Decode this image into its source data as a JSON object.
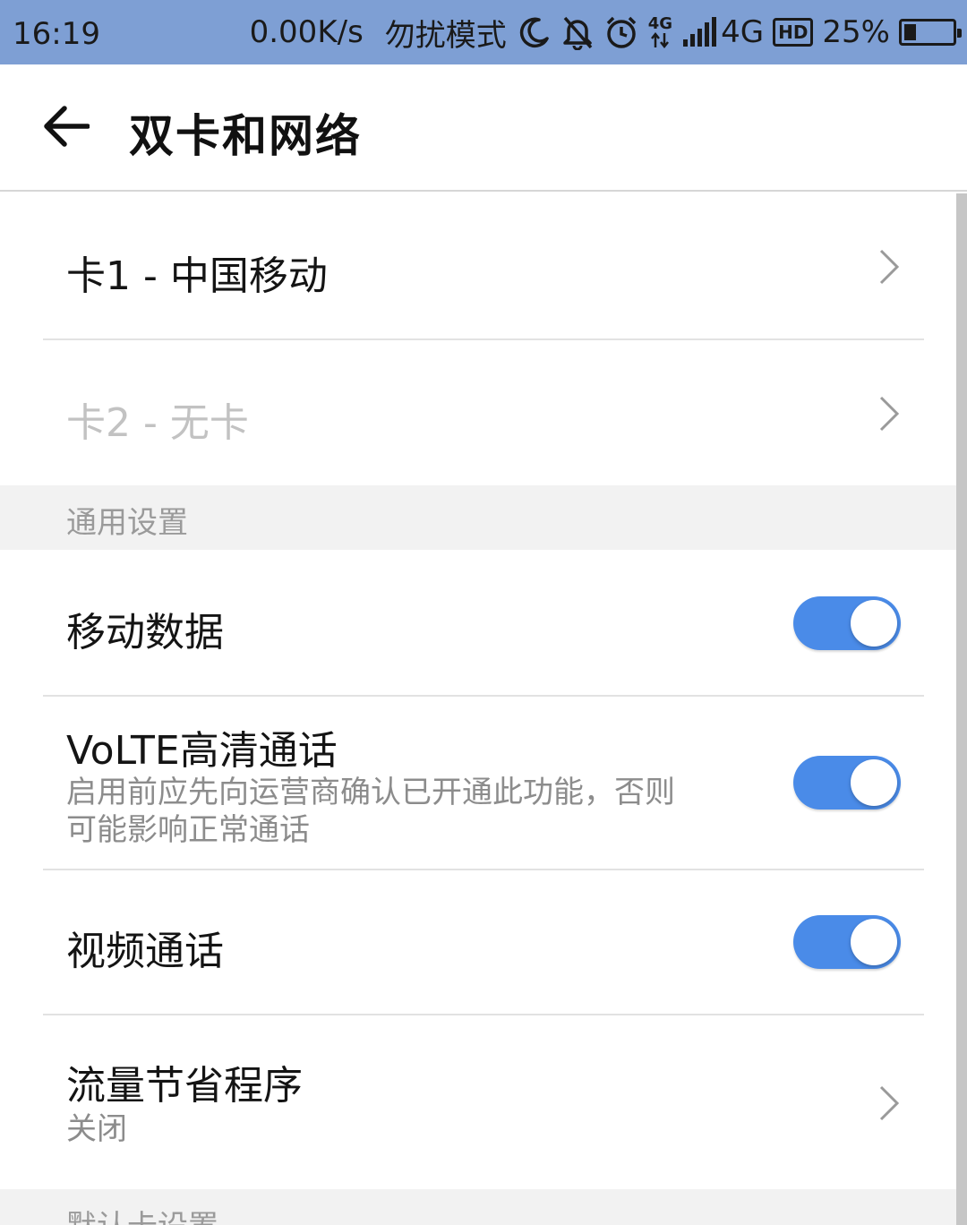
{
  "status_bar": {
    "time": "16:19",
    "net_speed": "0.00K/s",
    "dnd_label": "勿扰模式",
    "net_small": "4G",
    "net_type": "4G",
    "hd_badge": "HD",
    "battery_percent": "25%",
    "battery_level": 0.25,
    "icons": [
      "moon-icon",
      "bell-off-icon",
      "alarm-icon",
      "data-arrows-icon",
      "signal-icon",
      "battery-icon"
    ]
  },
  "header": {
    "title": "双卡和网络",
    "back_icon": "arrow-left-icon"
  },
  "sim_cards": [
    {
      "label": "卡1 - 中国移动",
      "enabled": true
    },
    {
      "label": "卡2 - 无卡",
      "enabled": false
    }
  ],
  "general_section": {
    "header": "通用设置",
    "items": [
      {
        "title": "移动数据",
        "toggle_on": true
      },
      {
        "title": "VoLTE高清通话",
        "subtitle_line1": "启用前应先向运营商确认已开通此功能，否则",
        "subtitle_line2": "可能影响正常通话",
        "toggle_on": true
      },
      {
        "title": "视频通话",
        "toggle_on": true
      },
      {
        "title": "流量节省程序",
        "subtitle": "关闭"
      }
    ]
  },
  "default_section": {
    "header": "默认卡设置"
  },
  "colors": {
    "status_bar": "#7e9fd4",
    "toggle_on": "#4a8be8",
    "section_bg": "#f2f2f2"
  }
}
